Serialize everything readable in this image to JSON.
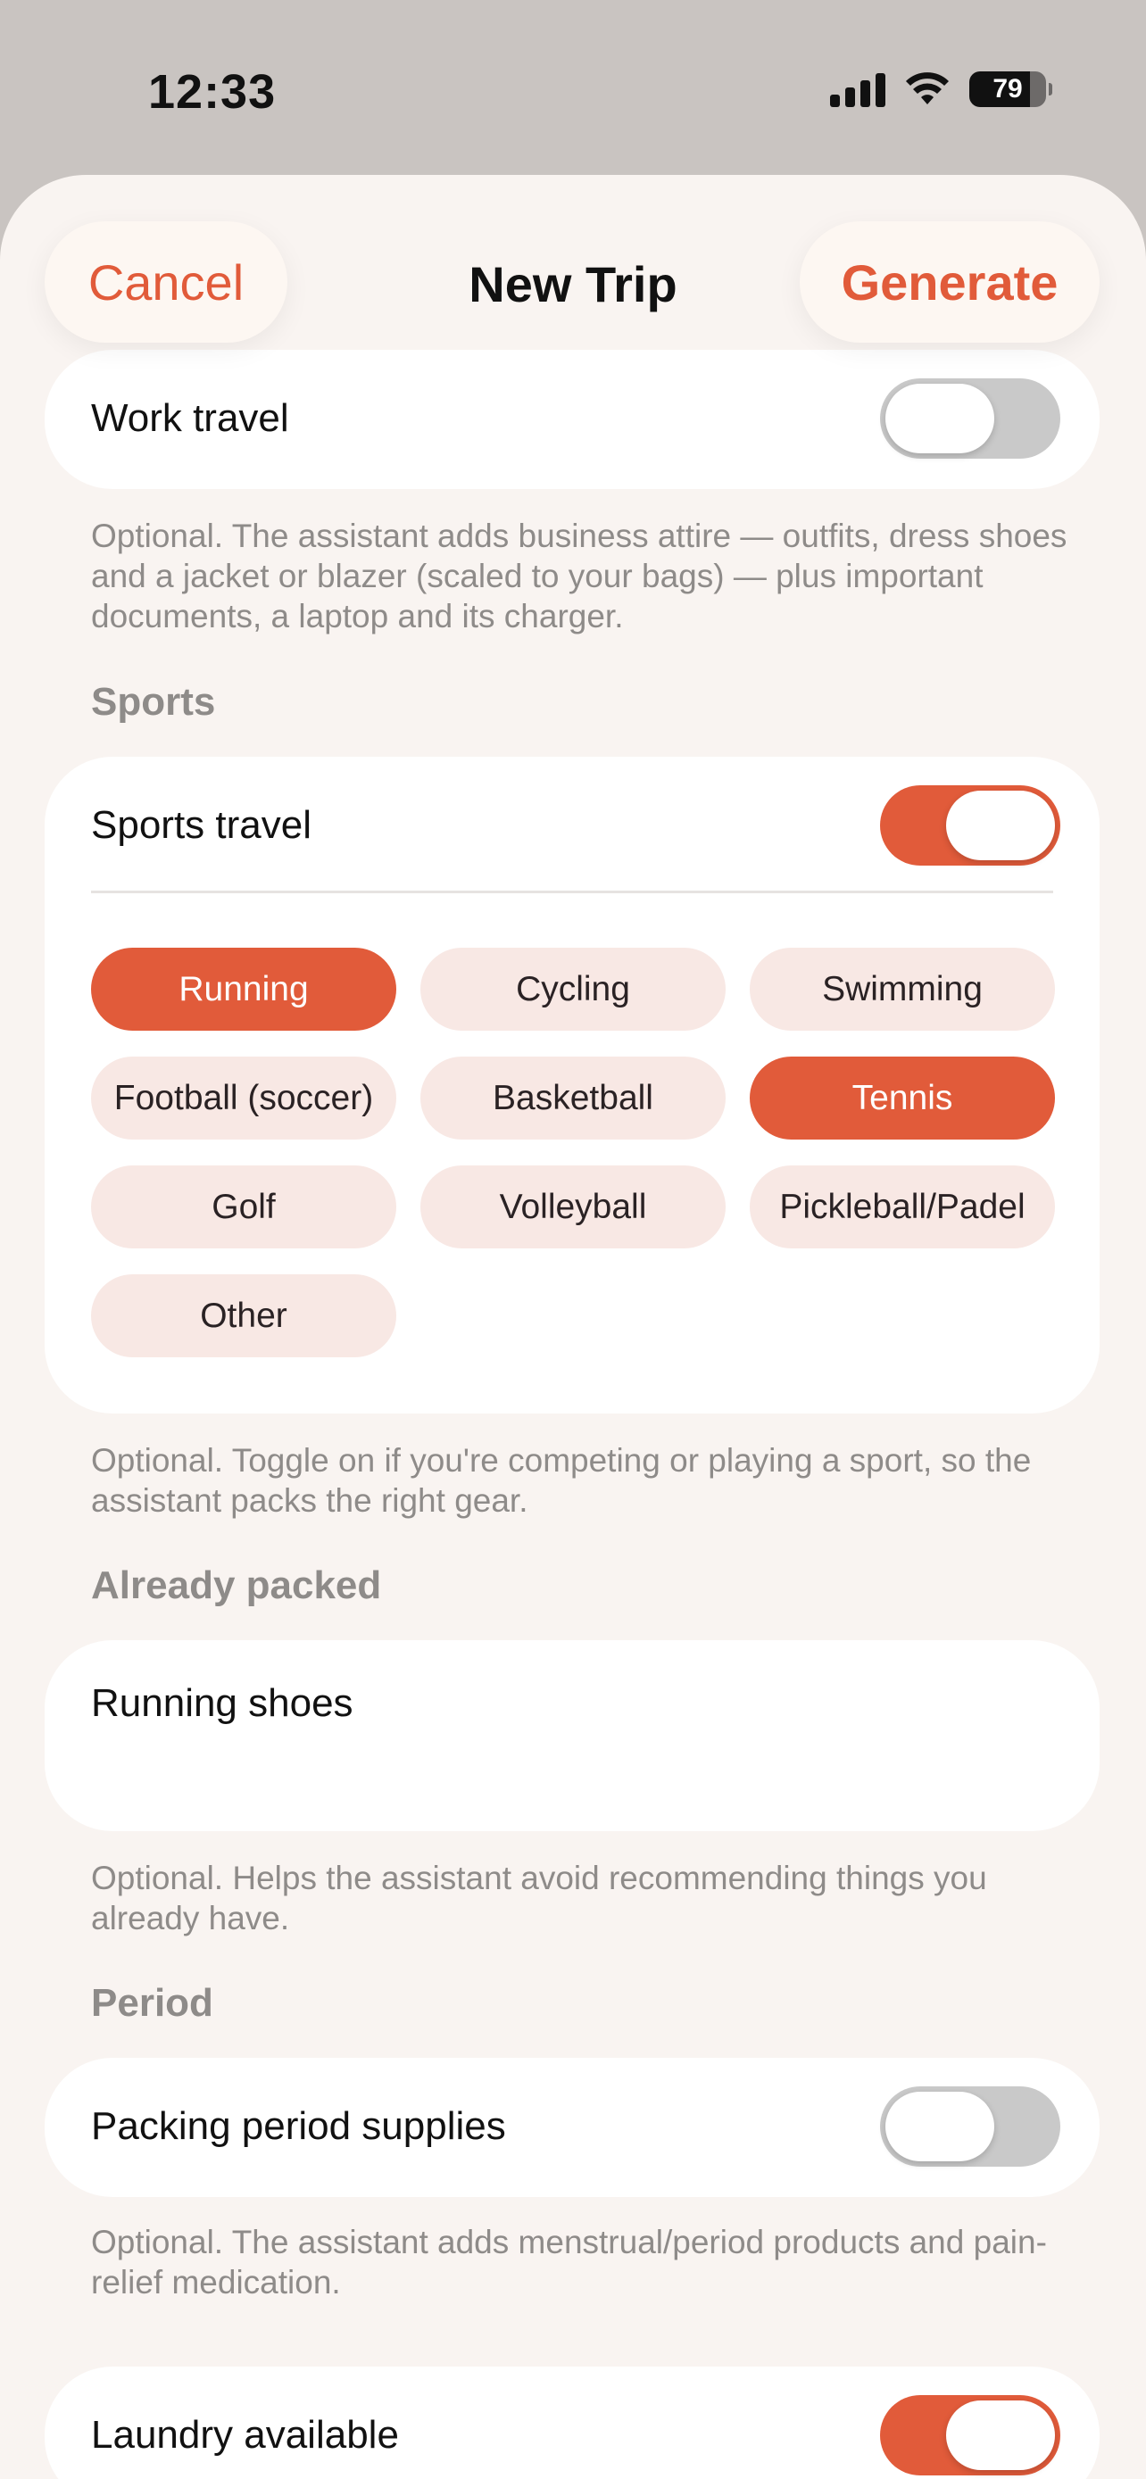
{
  "status_bar": {
    "time": "12:33",
    "battery_level": "79",
    "icons": [
      "cellular-signal-icon",
      "wifi-icon",
      "battery-icon"
    ]
  },
  "nav": {
    "cancel_label": "Cancel",
    "title": "New Trip",
    "generate_label": "Generate"
  },
  "work": {
    "label": "Work travel",
    "toggle_on": false,
    "footnote": "Optional. The assistant adds business attire — outfits, dress shoes and a jacket or blazer (scaled to your bags) — plus important documents, a laptop and its charger."
  },
  "sports": {
    "header": "Sports",
    "label": "Sports travel",
    "toggle_on": true,
    "chips": [
      {
        "label": "Running",
        "selected": true
      },
      {
        "label": "Cycling",
        "selected": false
      },
      {
        "label": "Swimming",
        "selected": false
      },
      {
        "label": "Football (soccer)",
        "selected": false
      },
      {
        "label": "Basketball",
        "selected": false
      },
      {
        "label": "Tennis",
        "selected": true
      },
      {
        "label": "Golf",
        "selected": false
      },
      {
        "label": "Volleyball",
        "selected": false
      },
      {
        "label": "Pickleball/Padel",
        "selected": false
      },
      {
        "label": "Other",
        "selected": false
      }
    ],
    "footnote": "Optional. Toggle on if you're competing or playing a sport, so the assistant packs the right gear."
  },
  "already_packed": {
    "header": "Already packed",
    "value": "Running shoes",
    "footnote": "Optional. Helps the assistant avoid recommending things you already have."
  },
  "period": {
    "header": "Period",
    "label": "Packing period supplies",
    "toggle_on": false,
    "footnote": "Optional. The assistant adds menstrual/period products and pain-relief medication."
  },
  "laundry": {
    "label": "Laundry available",
    "toggle_on": true
  },
  "colors": {
    "accent": "#e15b3a",
    "chip_background": "#f8e8e4",
    "sheet_background": "#f9f4f1",
    "toggle_off": "#c9c9c9"
  }
}
